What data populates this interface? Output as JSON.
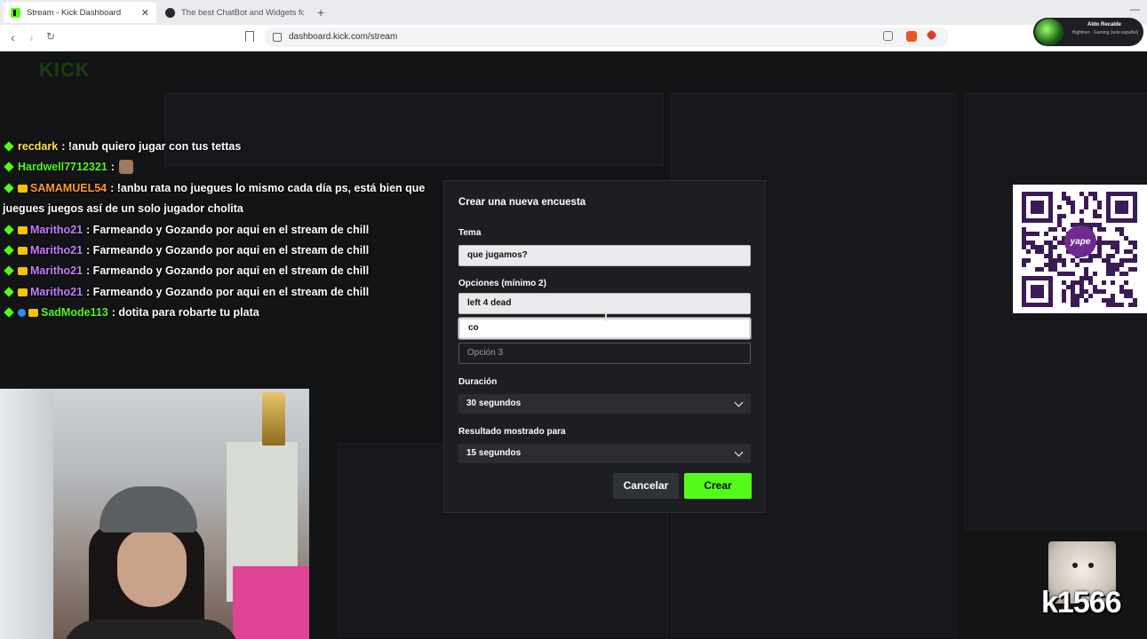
{
  "browser": {
    "tabs": [
      {
        "label": "Stream - Kick Dashboard",
        "active": true
      },
      {
        "label": "The best ChatBot and Widgets for Kic",
        "active": false
      }
    ],
    "url": "dashboard.kick.com/stream",
    "profile_name": "Aldo Recalde",
    "profile_sub": "Hightiver · Gaming (solo español)"
  },
  "dashboard": {
    "logo": "KICK"
  },
  "chat": [
    {
      "user": "recdark",
      "user_color": "#ffe24a",
      "text": ": !anub quiero jugar con tus tettas",
      "badges": []
    },
    {
      "user": "Hardwell7712321",
      "user_color": "#53fc18",
      "text": ":",
      "badges": [],
      "emote": true
    },
    {
      "user": "SAMAMUEL54",
      "user_color": "#ff9a2e",
      "text": ": !anbu rata no juegues lo mismo cada día ps, está bien que juegues juegos así de un solo jugador cholita",
      "badges": [
        "crown"
      ]
    },
    {
      "user": "Maritho21",
      "user_color": "#c77dff",
      "text": ": Farmeando y Gozando por aqui en el stream de chill",
      "badges": [
        "crown"
      ]
    },
    {
      "user": "Maritho21",
      "user_color": "#c77dff",
      "text": ": Farmeando y Gozando por aqui en el stream de chill",
      "badges": [
        "crown"
      ]
    },
    {
      "user": "Maritho21",
      "user_color": "#c77dff",
      "text": ": Farmeando y Gozando por aqui en el stream de chill",
      "badges": [
        "crown"
      ]
    },
    {
      "user": "Maritho21",
      "user_color": "#c77dff",
      "text": ": Farmeando y Gozando por aqui en el stream de chill",
      "badges": [
        "crown"
      ]
    },
    {
      "user": "SadMode113",
      "user_color": "#53fc18",
      "text": ": dotita para robarte tu plata",
      "badges": [
        "blue",
        "crown"
      ]
    }
  ],
  "overlay": {
    "pet_name": "k1566",
    "qr_brand": "yape"
  },
  "modal": {
    "title": "Crear una nueva encuesta",
    "topic_label": "Tema",
    "topic_value": "que jugamos?",
    "options_label": "Opciones (mínimo 2)",
    "options": [
      "left 4 dead",
      "co"
    ],
    "option3_placeholder": "Opción 3",
    "duration_label": "Duración",
    "duration_value": "30 segundos",
    "result_label": "Resultado mostrado para",
    "result_value": "15 segundos",
    "cancel_label": "Cancelar",
    "create_label": "Crear"
  },
  "colors": {
    "accent": "#53fc18",
    "modal_bg": "#1c1e21"
  }
}
